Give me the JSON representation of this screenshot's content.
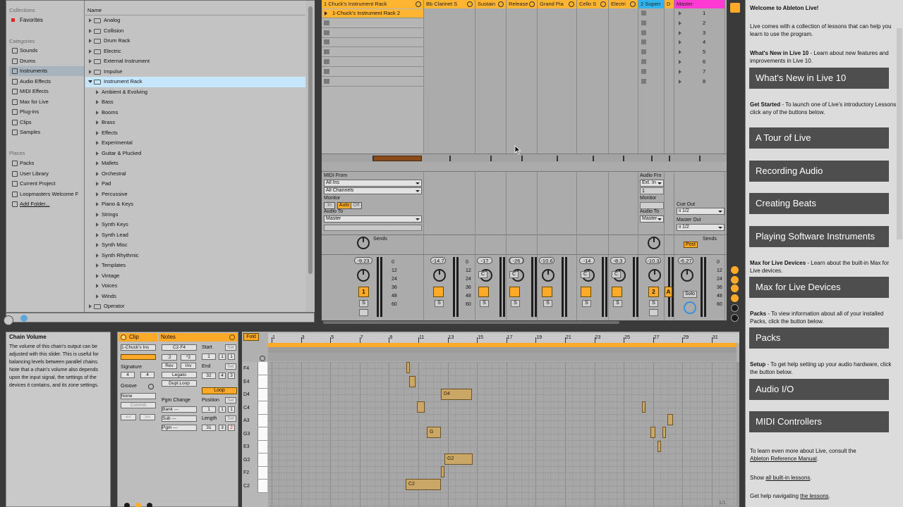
{
  "browser": {
    "collections_heading": "Collections",
    "favorites": "Favorites",
    "categories_heading": "Categories",
    "categories": [
      {
        "label": "Sounds",
        "icon": "note-icon"
      },
      {
        "label": "Drums",
        "icon": "drum-icon"
      },
      {
        "label": "Instruments",
        "icon": "instrument-icon"
      },
      {
        "label": "Audio Effects",
        "icon": "audio-effect-icon"
      },
      {
        "label": "MIDI Effects",
        "icon": "midi-effect-icon"
      },
      {
        "label": "Max for Live",
        "icon": "max-icon"
      },
      {
        "label": "Plug-ins",
        "icon": "plugin-icon"
      },
      {
        "label": "Clips",
        "icon": "clip-icon"
      },
      {
        "label": "Samples",
        "icon": "sample-icon"
      }
    ],
    "places_heading": "Places",
    "places": [
      "Packs",
      "User Library",
      "Current Project",
      "Loopmasters Welcome F",
      "Add Folder..."
    ],
    "name_column": "Name",
    "items": [
      "Analog",
      "Collision",
      "Drum Rack",
      "Electric",
      "External Instrument",
      "Impulse",
      "Instrument Rack"
    ],
    "subitems": [
      "Ambient & Evolving",
      "Bass",
      "Booms",
      "Brass",
      "Effects",
      "Experimental",
      "Guitar & Plucked",
      "Mallets",
      "Orchestral",
      "Pad",
      "Percussive",
      "Piano & Keys",
      "Strings",
      "Synth Keys",
      "Synth Lead",
      "Synth Misc",
      "Synth Rhythmic",
      "Templates",
      "Vintage",
      "Voices",
      "Winds"
    ],
    "last_item": "Operator"
  },
  "session": {
    "tracks": [
      {
        "name": "1 Chuck's Instrument Rack",
        "color": "#ffb532"
      },
      {
        "name": "Bb Clarinet S",
        "color": "#ffb532"
      },
      {
        "name": "Sustain",
        "color": "#ffb532"
      },
      {
        "name": "Release",
        "color": "#ffb532"
      },
      {
        "name": "Grand Pia",
        "color": "#ffb532"
      },
      {
        "name": "Cello S",
        "color": "#ffb532"
      },
      {
        "name": "Electri",
        "color": "#ffb532"
      },
      {
        "name": "2 Superr",
        "color": "#2fb4ef"
      },
      {
        "name": "D",
        "color": "#ffb532"
      },
      {
        "name": "Master",
        "color": "#ff39d4"
      }
    ],
    "clip_name": "1-Chuck's Instrument Rack 2",
    "scenes": [
      "1",
      "2",
      "3",
      "4",
      "5",
      "6",
      "7",
      "8"
    ],
    "io": {
      "midi_from_label": "MIDI From",
      "midi_from_value": "All Ins",
      "channels_value": "All Channels",
      "monitor_label": "Monitor",
      "monitor_options": [
        "In",
        "Auto",
        "Off"
      ],
      "audio_to_label": "Audio To",
      "audio_to_value": "Master",
      "audio_from_label": "Audio Fro",
      "audio_from_value": "Ext. In",
      "audio_from_channel": "1",
      "monitor2_label": "Monitor",
      "audio_to2_label": "Audio To",
      "audio_to2_value": "Master",
      "cue_out_label": "Cue Out",
      "cue_out_value": "ii 1/2",
      "master_out_label": "Master Out",
      "master_out_value": "ii 1/2"
    },
    "sends_label": "Sends",
    "sends_label_master": "Sends",
    "post_label": "Post",
    "mixer": {
      "volumes": [
        "-9.23",
        "-14.7",
        "-17",
        "-",
        "-10.6",
        "-14",
        "-8.3",
        "-10.3",
        "-6.27"
      ],
      "volume_d": "-26",
      "scale": [
        "0",
        "12",
        "24",
        "36",
        "48",
        "60"
      ],
      "activator_1": "1",
      "activator_2": "2",
      "activator_a": "A",
      "solo_label": "S",
      "solo_master": "Solo",
      "cue_labels": [
        "C",
        "C",
        "C",
        "C"
      ]
    }
  },
  "help": {
    "title": "Welcome to Ableton Live!",
    "intro": "Live comes with a collection of lessons that can help you learn to use the program.",
    "whats_new_bold": "What's New in Live 10",
    "whats_new_text": " - Learn about new features and improvements in Live 10.",
    "btn_whats_new": "What's New in Live 10",
    "get_started_bold": "Get Started",
    "get_started_text": " - To launch one of Live's introductory Lessons, click any of the buttons below.",
    "btn_tour": "A Tour of Live",
    "btn_recording": "Recording Audio",
    "btn_beats": "Creating Beats",
    "btn_software": "Playing Software Instruments",
    "max_bold": "Max for Live Devices",
    "max_text": " - Learn about the built-in Max for Live devices.",
    "btn_max": "Max for Live Devices",
    "packs_bold": "Packs",
    "packs_text": " - To view information about all of your installed Packs, click the button below.",
    "btn_packs": "Packs",
    "setup_bold": "Setup",
    "setup_text": " - To get help setting up your audio hardware, click the button below.",
    "btn_audio_io": "Audio I/O",
    "btn_midi": "MIDI Controllers",
    "more_text": "To learn even more about Live, consult the",
    "manual_link": "Ableton Reference Manual",
    "show_prefix": "Show",
    "all_lessons_link": "all built-in lessons",
    "nav_prefix": "Get help navigating",
    "nav_link": "the lessons"
  },
  "info_view": {
    "title": "Chain Volume",
    "text": "The volume of this chain's output can be adjusted with this slider. This is useful for balancing levels between parallel chains. Note that a chain's volume also depends upon the input signal, the settings of the devices it contains, and its zone settings."
  },
  "clip_view": {
    "clip_label": "Clip",
    "clip_name": "1-Chuck's Ins",
    "signature_label": "Signature",
    "sig_num": "4",
    "sig_den": "4",
    "groove_label": "Groove",
    "groove_value": "None",
    "commit": "Commit",
    "notes_label": "Notes",
    "range": "C2-F4",
    "transpose_down": ":2",
    "transpose_up": "*2",
    "rev": "Rev",
    "inv": "Inv",
    "legato": "Legato",
    "dupl_loop": "Dupl.Loop",
    "pgm_change": "Pgm Change",
    "bank": "Bank ---",
    "sub": "Sub ---",
    "pgm": "Pgm ---",
    "start_label": "Start",
    "set": "Set",
    "start_vals": [
      "1",
      "1",
      "1"
    ],
    "end_label": "End",
    "end_vals": [
      "32",
      "4",
      "3"
    ],
    "loop": "Loop",
    "position_label": "Position",
    "position_vals": [
      "1",
      "1",
      "1"
    ],
    "length_label": "Length",
    "length_vals": [
      "31",
      "3",
      "2"
    ]
  },
  "editor": {
    "fold": "Fold",
    "ruler": [
      "1",
      "3",
      "5",
      "7",
      "9",
      "11",
      "13",
      "15",
      "17",
      "19",
      "21",
      "23",
      "25",
      "27",
      "29",
      "31"
    ],
    "keys": [
      "F4",
      "E4",
      "D4",
      "C4",
      "A3",
      "G3",
      "E3",
      "G2",
      "F2",
      "C2"
    ],
    "notes": [
      {
        "label": "D4"
      },
      {
        "label": "G"
      },
      {
        "label": "G2"
      },
      {
        "label": "C2"
      }
    ],
    "page": "1/1"
  }
}
